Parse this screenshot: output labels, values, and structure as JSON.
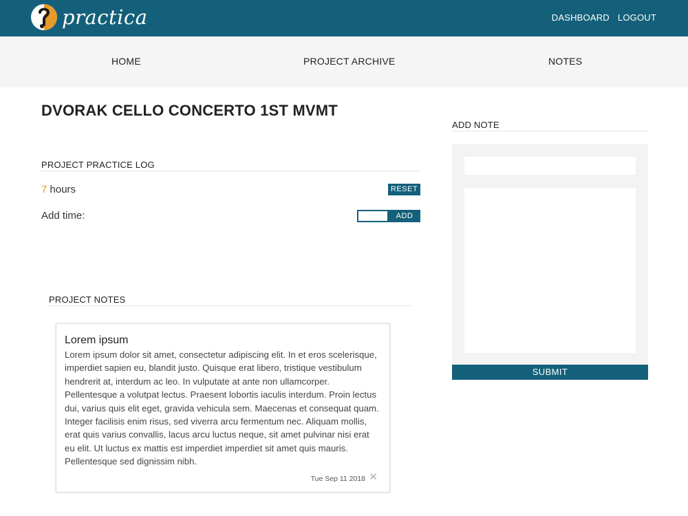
{
  "header": {
    "brand": "practica",
    "links": [
      "DASHBOARD",
      "LOGOUT"
    ],
    "bar_color": "#14607a"
  },
  "nav": {
    "items": [
      "HOME",
      "PROJECT ARCHIVE",
      "NOTES"
    ]
  },
  "project": {
    "title": "DVORAK CELLO CONCERTO 1ST MVMT",
    "practice_log": {
      "heading": "PROJECT PRACTICE LOG",
      "hours_value": "7",
      "hours_unit": "hours",
      "reset_label": "RESET",
      "add_time_label": "Add time:",
      "add_time_value": "",
      "add_label": "ADD"
    },
    "notes": {
      "heading": "PROJECT NOTES",
      "items": [
        {
          "title": "Lorem ipsum",
          "body": "Lorem ipsum dolor sit amet, consectetur adipiscing elit. In et eros scelerisque, imperdiet sapien eu, blandit justo. Quisque erat libero, tristique vestibulum hendrerit at, interdum ac leo. In vulputate at ante non ullamcorper. Pellentesque a volutpat lectus. Praesent lobortis iaculis interdum. Proin lectus dui, varius quis elit eget, gravida vehicula sem. Maecenas et consequat quam. Integer facilisis enim risus, sed viverra arcu fermentum nec. Aliquam mollis, erat quis varius convallis, lacus arcu luctus neque, sit amet pulvinar nisi erat eu elit. Ut luctus ex mattis est imperdiet imperdiet sit amet quis mauris. Pellentesque sed dignissim nibh.",
          "date": "Tue Sep 11 2018",
          "delete_icon": "close-icon"
        }
      ]
    }
  },
  "add_note": {
    "heading": "ADD NOTE",
    "title_value": "",
    "body_value": "",
    "submit_label": "SUBMIT"
  },
  "colors": {
    "accent": "#14607a",
    "hours_highlight": "#e69a2a",
    "nav_background": "#f5f5f5",
    "form_background": "#f3f3f3"
  }
}
